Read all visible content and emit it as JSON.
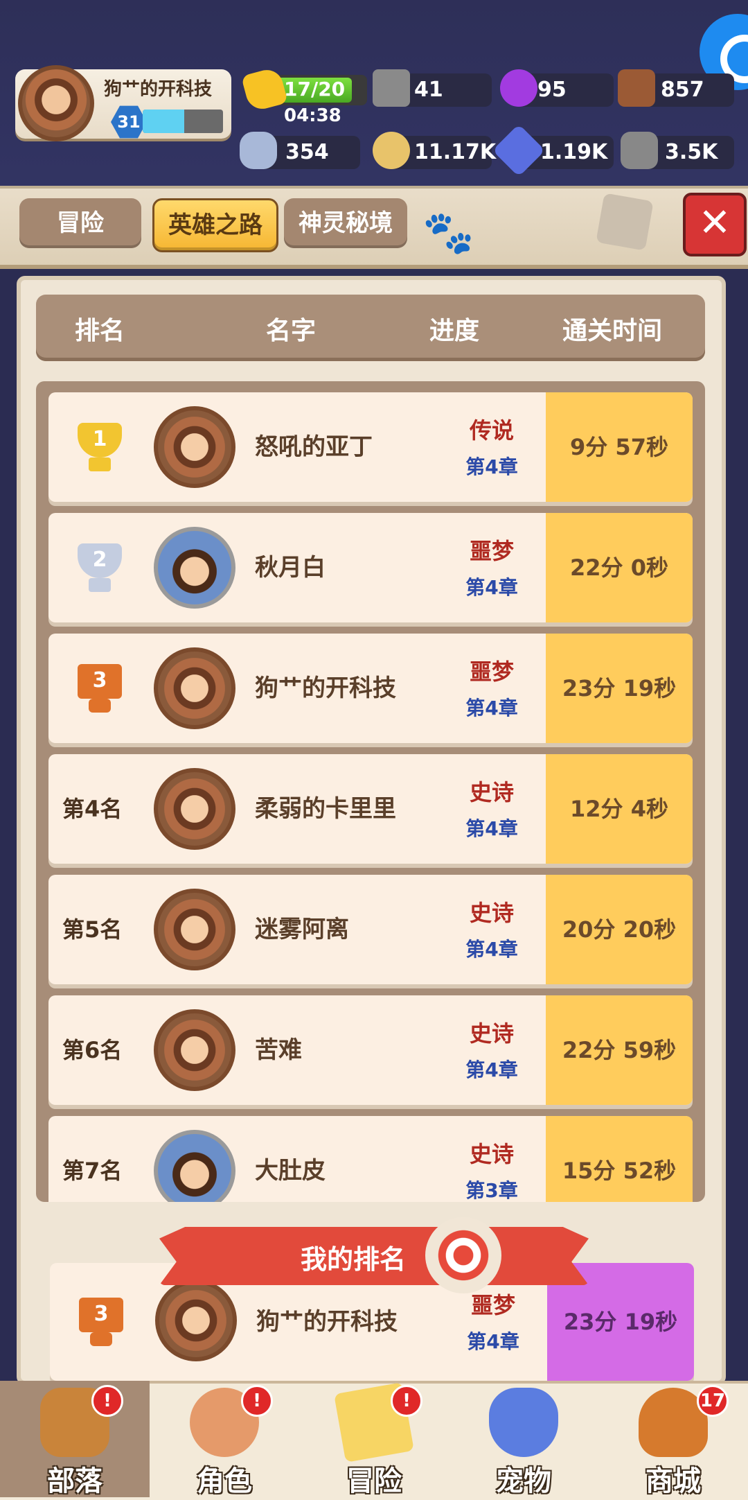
{
  "player": {
    "name": "狗艹的开科技",
    "level": "31"
  },
  "resources": {
    "energy": "17/20",
    "energy_timer": "04:38",
    "r1": "41",
    "r2": "95",
    "r3": "857",
    "r4": "354",
    "r5": "11.17K",
    "r6": "1.19K",
    "r7": "3.5K"
  },
  "tabs": [
    "冒险",
    "英雄之路",
    "神灵秘境"
  ],
  "header": {
    "rank": "排名",
    "name": "名字",
    "progress": "进度",
    "time": "通关时间"
  },
  "rows": [
    {
      "rank": "1",
      "name": "怒吼的亚丁",
      "tier": "传说",
      "chapter": "第4章",
      "time": "9分 57秒"
    },
    {
      "rank": "2",
      "name": "秋月白",
      "tier": "噩梦",
      "chapter": "第4章",
      "time": "22分 0秒"
    },
    {
      "rank": "3",
      "name": "狗艹的开科技",
      "tier": "噩梦",
      "chapter": "第4章",
      "time": "23分 19秒"
    },
    {
      "rank": "第4名",
      "name": "柔弱的卡里里",
      "tier": "史诗",
      "chapter": "第4章",
      "time": "12分 4秒"
    },
    {
      "rank": "第5名",
      "name": "迷雾阿离",
      "tier": "史诗",
      "chapter": "第4章",
      "time": "20分 20秒"
    },
    {
      "rank": "第6名",
      "name": "苦难",
      "tier": "史诗",
      "chapter": "第4章",
      "time": "22分 59秒"
    },
    {
      "rank": "第7名",
      "name": "大肚皮",
      "tier": "史诗",
      "chapter": "第3章",
      "time": "15分 52秒"
    }
  ],
  "my_rank": {
    "title": "我的排名",
    "rank": "3",
    "name": "狗艹的开科技",
    "tier": "噩梦",
    "chapter": "第4章",
    "time": "23分 19秒"
  },
  "nav": [
    {
      "label": "部落",
      "badge": "!"
    },
    {
      "label": "角色",
      "badge": "!"
    },
    {
      "label": "冒险",
      "badge": "!"
    },
    {
      "label": "宠物",
      "badge": ""
    },
    {
      "label": "商城",
      "badge": "17"
    }
  ]
}
